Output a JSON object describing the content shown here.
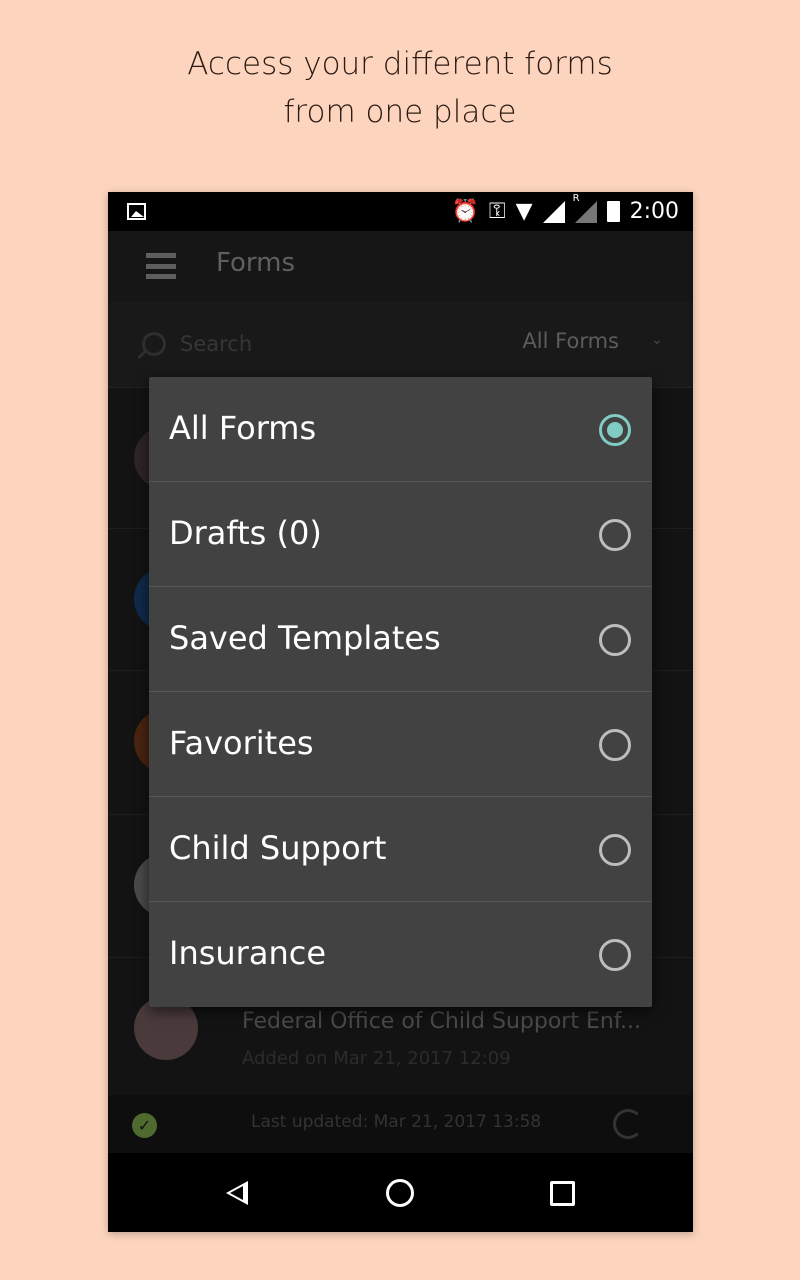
{
  "caption": {
    "line1": "Access your different forms",
    "line2": "from one place"
  },
  "status_bar": {
    "time": "2:00",
    "roaming": "R",
    "icons": [
      "image-icon",
      "alarm-icon",
      "vpn-key-icon",
      "wifi-icon",
      "signal-icon",
      "signal-roaming-icon",
      "battery-icon"
    ]
  },
  "toolbar": {
    "title": "Forms"
  },
  "search": {
    "placeholder": "Search",
    "filter_value": "All Forms"
  },
  "list": {
    "items": [
      {
        "title": "",
        "subtitle": ""
      },
      {
        "title": "",
        "subtitle": ""
      },
      {
        "title": "",
        "subtitle": ""
      },
      {
        "title": "",
        "subtitle": ""
      },
      {
        "title": "Federal Office of Child Support Enf...",
        "subtitle": "Added on Mar 21, 2017 12:09"
      }
    ]
  },
  "footer": {
    "status": "Last updated: Mar 21, 2017 13:58"
  },
  "menu": {
    "accent": "#80cbc4",
    "selected": "All Forms",
    "options": [
      {
        "label": "All Forms"
      },
      {
        "label": "Drafts (0)"
      },
      {
        "label": "Saved Templates"
      },
      {
        "label": "Favorites"
      },
      {
        "label": "Child Support"
      },
      {
        "label": "Insurance"
      }
    ]
  }
}
